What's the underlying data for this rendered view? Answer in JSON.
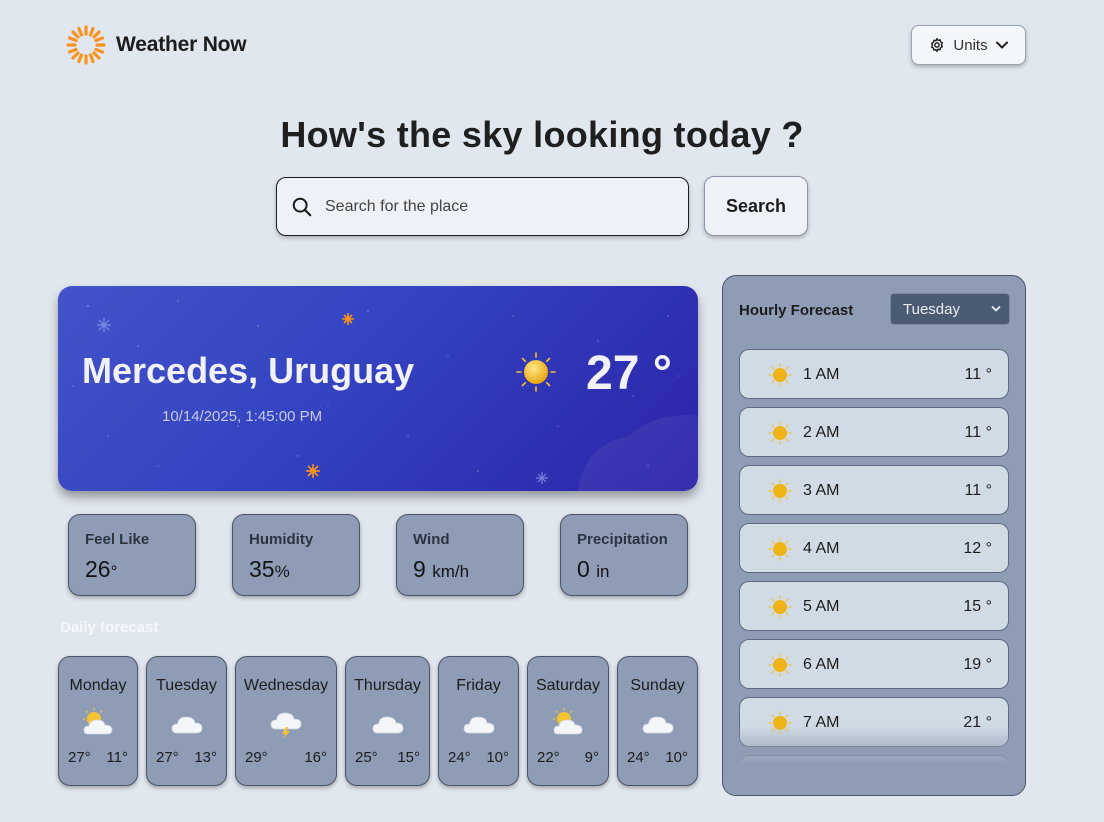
{
  "app": {
    "title": "Weather Now",
    "units_label": "Units"
  },
  "hero": {
    "title": "How's the sky looking today ?",
    "search_placeholder": "Search for the place",
    "search_button": "Search"
  },
  "current": {
    "location": "Mercedes, Uruguay",
    "datetime": "10/14/2025, 1:45:00 PM",
    "temperature": "27 °",
    "icon": "sun-icon"
  },
  "stats": [
    {
      "label": "Feel Like",
      "value": "26",
      "unit": "°"
    },
    {
      "label": "Humidity",
      "value": "35",
      "unit": "%"
    },
    {
      "label": "Wind",
      "value": "9",
      "unit": "km/h"
    },
    {
      "label": "Precipitation",
      "value": "0",
      "unit": "in"
    }
  ],
  "daily": {
    "title": "Daily forecast",
    "days": [
      {
        "name": "Monday",
        "icon": "partly-cloudy-icon",
        "high": "27°",
        "low": "11°"
      },
      {
        "name": "Tuesday",
        "icon": "cloud-icon",
        "high": "27°",
        "low": "13°"
      },
      {
        "name": "Wednesday",
        "icon": "storm-icon",
        "high": "29°",
        "low": "16°"
      },
      {
        "name": "Thursday",
        "icon": "cloud-icon",
        "high": "25°",
        "low": "15°"
      },
      {
        "name": "Friday",
        "icon": "cloud-icon",
        "high": "24°",
        "low": "10°"
      },
      {
        "name": "Saturday",
        "icon": "partly-cloudy-icon",
        "high": "22°",
        "low": "9°"
      },
      {
        "name": "Sunday",
        "icon": "cloud-icon",
        "high": "24°",
        "low": "10°"
      }
    ]
  },
  "hourly": {
    "title": "Hourly Forecast",
    "selected_day": "Tuesday",
    "hours": [
      {
        "time": "1 AM",
        "temp": "11 °",
        "icon": "sun-icon"
      },
      {
        "time": "2 AM",
        "temp": "11 °",
        "icon": "sun-icon"
      },
      {
        "time": "3 AM",
        "temp": "11 °",
        "icon": "sun-icon"
      },
      {
        "time": "4 AM",
        "temp": "12 °",
        "icon": "sun-icon"
      },
      {
        "time": "5 AM",
        "temp": "15 °",
        "icon": "sun-icon"
      },
      {
        "time": "6 AM",
        "temp": "19 °",
        "icon": "sun-icon"
      },
      {
        "time": "7 AM",
        "temp": "21 °",
        "icon": "sun-icon"
      }
    ]
  },
  "colors": {
    "background": "#e1e7ef",
    "card": "#8e9db5",
    "hero_gradient_start": "#4353c9",
    "hero_gradient_end": "#2b22a8",
    "logo_orange": "#f7931e"
  }
}
